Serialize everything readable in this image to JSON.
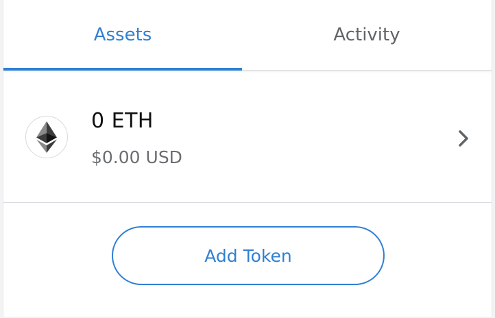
{
  "tabs": [
    {
      "label": "Assets",
      "active": true
    },
    {
      "label": "Activity",
      "active": false
    }
  ],
  "asset": {
    "icon": "ethereum-icon",
    "balance": "0 ETH",
    "fiat": "$0.00 USD"
  },
  "add_token": {
    "label": "Add Token"
  },
  "colors": {
    "accent": "#2f7fd3",
    "text_primary": "#111111",
    "text_secondary": "#6a6e72",
    "divider": "#dadcdf"
  }
}
